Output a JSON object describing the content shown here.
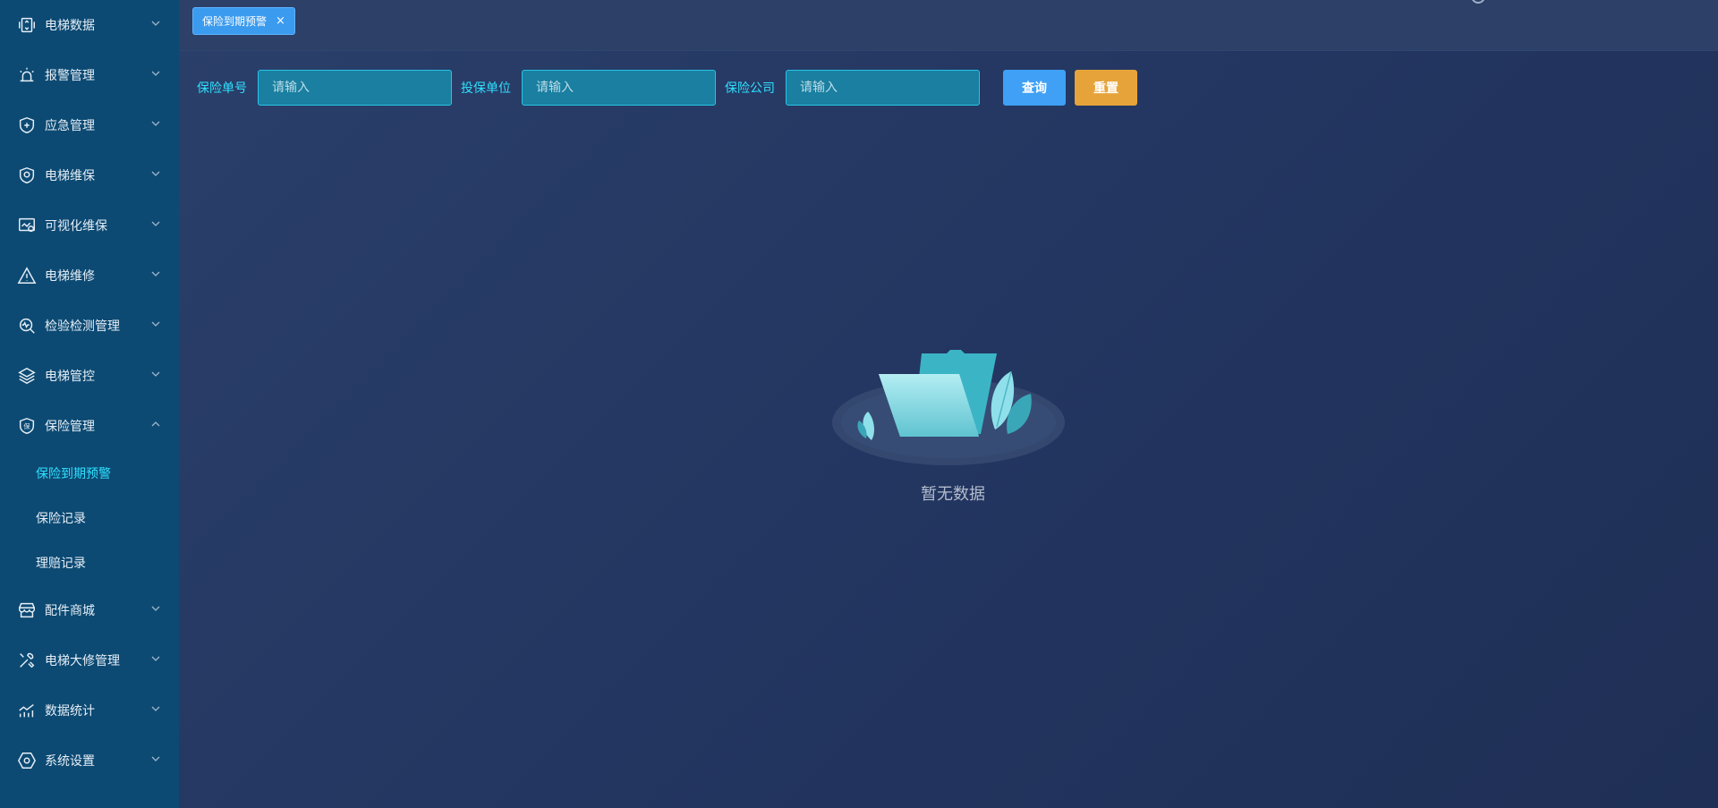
{
  "sidebar": {
    "items": [
      {
        "label": "电梯数据",
        "icon": "elevator-data-icon"
      },
      {
        "label": "报警管理",
        "icon": "alarm-icon"
      },
      {
        "label": "应急管理",
        "icon": "shield-plus-icon"
      },
      {
        "label": "电梯维保",
        "icon": "shield-maintenance-icon"
      },
      {
        "label": "可视化维保",
        "icon": "visual-maintenance-icon"
      },
      {
        "label": "电梯维修",
        "icon": "warning-icon"
      },
      {
        "label": "检验检测管理",
        "icon": "inspection-icon"
      },
      {
        "label": "电梯管控",
        "icon": "layers-icon"
      },
      {
        "label": "保险管理",
        "icon": "insurance-icon"
      },
      {
        "label": "配件商城",
        "icon": "store-icon"
      },
      {
        "label": "电梯大修管理",
        "icon": "tools-icon"
      },
      {
        "label": "数据统计",
        "icon": "stats-icon"
      },
      {
        "label": "系统设置",
        "icon": "settings-icon"
      }
    ],
    "insurance_sub": [
      {
        "label": "保险到期预警",
        "active": true
      },
      {
        "label": "保险记录",
        "active": false
      },
      {
        "label": "理赔记录",
        "active": false
      }
    ]
  },
  "tabs": [
    {
      "label": "保险到期预警",
      "close": "×"
    }
  ],
  "filters": {
    "policy_no_label": "保险单号",
    "policy_no_placeholder": "请输入",
    "insured_unit_label": "投保单位",
    "insured_unit_placeholder": "请输入",
    "company_label": "保险公司",
    "company_placeholder": "请输入",
    "query_label": "查询",
    "reset_label": "重置"
  },
  "empty": {
    "text": "暂无数据"
  },
  "colors": {
    "sidebar_bg": "#0c4a73",
    "accent_cyan": "#2fe0ff",
    "query_btn": "#3fa0f5",
    "reset_btn": "#e6a33a"
  }
}
